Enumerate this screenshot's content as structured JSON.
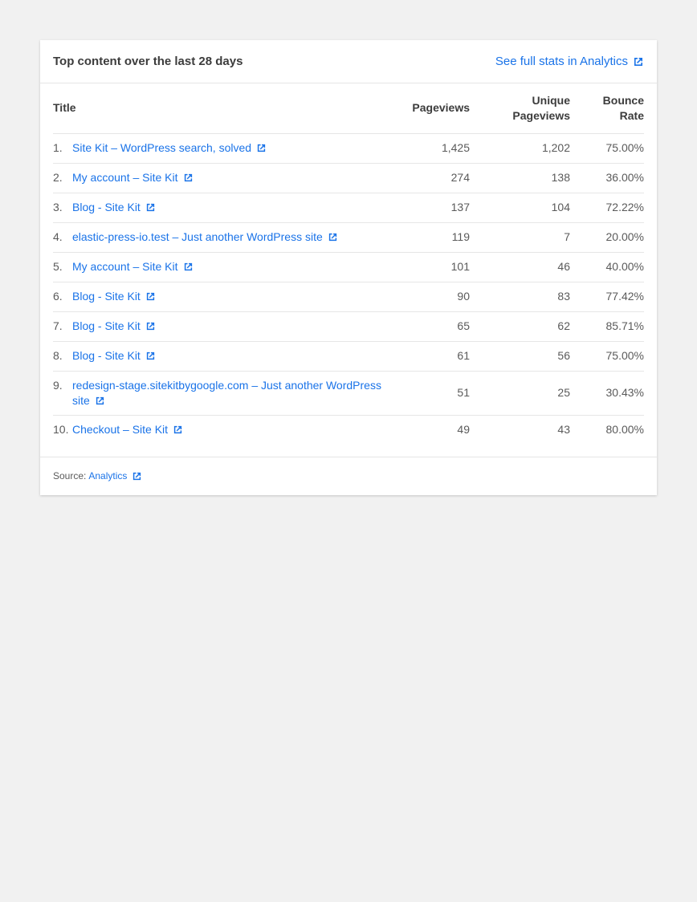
{
  "header": {
    "title": "Top content over the last 28 days",
    "link_label": "See full stats in Analytics"
  },
  "table": {
    "columns": {
      "title": "Title",
      "pageviews": "Pageviews",
      "unique_line1": "Unique",
      "unique_line2": "Pageviews",
      "bounce_line1": "Bounce",
      "bounce_line2": "Rate"
    },
    "rows": [
      {
        "rank": "1.",
        "title": "Site Kit – WordPress search, solved",
        "pageviews": "1,425",
        "unique": "1,202",
        "bounce": "75.00%"
      },
      {
        "rank": "2.",
        "title": "My account – Site Kit",
        "pageviews": "274",
        "unique": "138",
        "bounce": "36.00%"
      },
      {
        "rank": "3.",
        "title": "Blog - Site Kit",
        "pageviews": "137",
        "unique": "104",
        "bounce": "72.22%"
      },
      {
        "rank": "4.",
        "title": "elastic-press-io.test – Just another WordPress site",
        "pageviews": "119",
        "unique": "7",
        "bounce": "20.00%"
      },
      {
        "rank": "5.",
        "title": "My account – Site Kit",
        "pageviews": "101",
        "unique": "46",
        "bounce": "40.00%"
      },
      {
        "rank": "6.",
        "title": "Blog - Site Kit",
        "pageviews": "90",
        "unique": "83",
        "bounce": "77.42%"
      },
      {
        "rank": "7.",
        "title": "Blog - Site Kit",
        "pageviews": "65",
        "unique": "62",
        "bounce": "85.71%"
      },
      {
        "rank": "8.",
        "title": "Blog - Site Kit",
        "pageviews": "61",
        "unique": "56",
        "bounce": "75.00%"
      },
      {
        "rank": "9.",
        "title": "redesign-stage.sitekitbygoogle.com – Just another WordPress site",
        "pageviews": "51",
        "unique": "25",
        "bounce": "30.43%"
      },
      {
        "rank": "10.",
        "title": "Checkout – Site Kit",
        "pageviews": "49",
        "unique": "43",
        "bounce": "80.00%"
      }
    ]
  },
  "footer": {
    "source_label": "Source:",
    "source_link": "Analytics"
  },
  "icons": {
    "external_link": "external-link-icon"
  },
  "colors": {
    "link": "#1a73e8",
    "background": "#f1f1f1",
    "card": "#ffffff"
  }
}
